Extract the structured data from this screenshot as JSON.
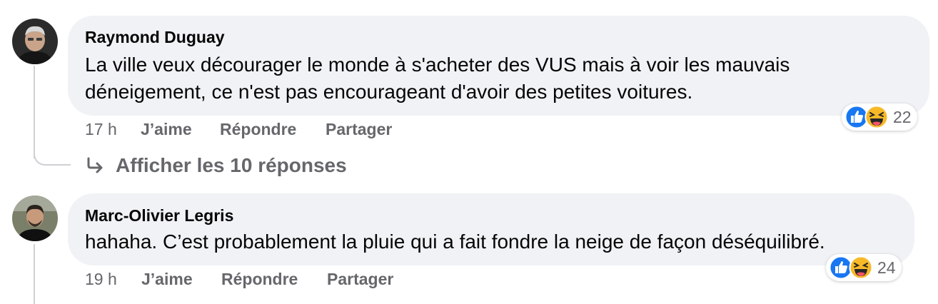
{
  "comments": [
    {
      "author": "Raymond Duguay",
      "text_lines": [
        "La ville veux décourager le monde à s'acheter des VUS mais à voir les mauvais",
        "déneigement, ce n'est pas encourageant d'avoir des petites voitures."
      ],
      "time": "17 h",
      "like_label": "J’aime",
      "reply_label": "Répondre",
      "share_label": "Partager",
      "reaction_count": "22",
      "reaction_icons": [
        "like-icon",
        "haha-icon"
      ],
      "replies_link": "Afficher les 10 réponses"
    },
    {
      "author": "Marc-Olivier Legris",
      "text_lines": [
        "hahaha. C’est probablement la pluie qui a fait fondre la neige de façon déséquilibré."
      ],
      "time": "19 h",
      "like_label": "J’aime",
      "reply_label": "Répondre",
      "share_label": "Partager",
      "reaction_count": "24",
      "reaction_icons": [
        "like-icon",
        "haha-icon"
      ]
    }
  ],
  "colors": {
    "bubble": "#f0f2f5",
    "meta_text": "#65676b",
    "like_blue": "#1877f2",
    "haha_yellow": "#f7b928"
  }
}
